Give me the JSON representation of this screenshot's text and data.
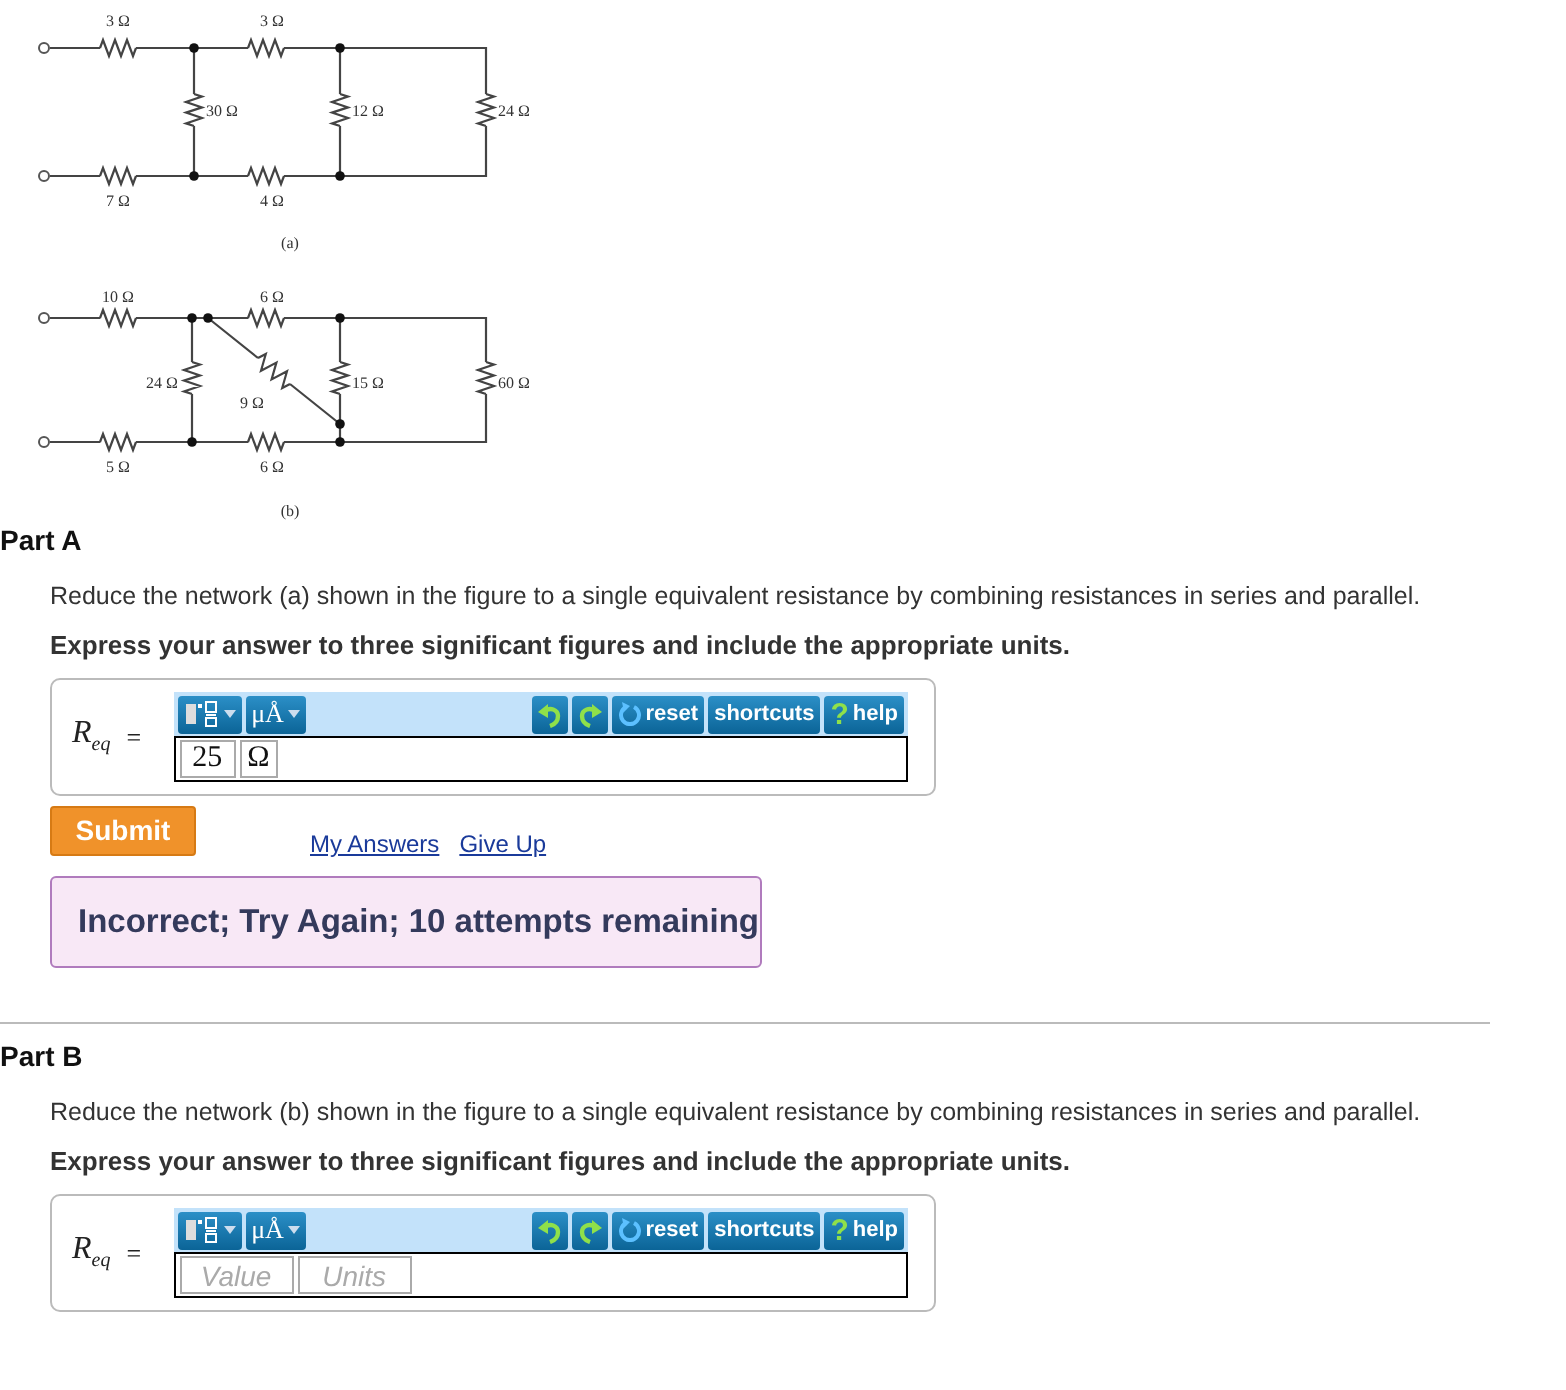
{
  "figure": {
    "circuits": [
      {
        "caption": "(a)",
        "resistors": [
          "3 Ω",
          "3 Ω",
          "30 Ω",
          "12 Ω",
          "24 Ω",
          "7 Ω",
          "4 Ω"
        ]
      },
      {
        "caption": "(b)",
        "resistors": [
          "10 Ω",
          "6 Ω",
          "24 Ω",
          "9 Ω",
          "15 Ω",
          "60 Ω",
          "5 Ω",
          "6 Ω"
        ]
      }
    ]
  },
  "parts": [
    {
      "title": "Part A",
      "prompt": "Reduce the network (a) shown in the figure to a single equivalent resistance by combining resistances in series and parallel.",
      "instruction": "Express your answer to three significant figures and include the appropriate units.",
      "answer": {
        "variable": "R$_{eq}$",
        "equals": "=",
        "toolbar": {
          "units_button": "μÅ",
          "reset": "reset",
          "shortcuts": "shortcuts",
          "help_mark": "?",
          "help": "help"
        },
        "value_field": {
          "value": "25"
        },
        "units_field": {
          "value": "Ω"
        }
      },
      "submit": "Submit",
      "links": [
        "My Answers",
        "Give Up"
      ],
      "feedback": "Incorrect; Try Again; 10 attempts remaining"
    },
    {
      "title": "Part B",
      "prompt": "Reduce the network (b) shown in the figure to a single equivalent resistance by combining resistances in series and parallel.",
      "instruction": "Express your answer to three significant figures and include the appropriate units.",
      "answer": {
        "variable": "R$_{eq}$",
        "equals": "=",
        "toolbar": {
          "units_button": "μÅ",
          "reset": "reset",
          "shortcuts": "shortcuts",
          "help_mark": "?",
          "help": "help"
        },
        "value_field": {
          "placeholder": "Value"
        },
        "units_field": {
          "placeholder": "Units"
        }
      }
    }
  ]
}
